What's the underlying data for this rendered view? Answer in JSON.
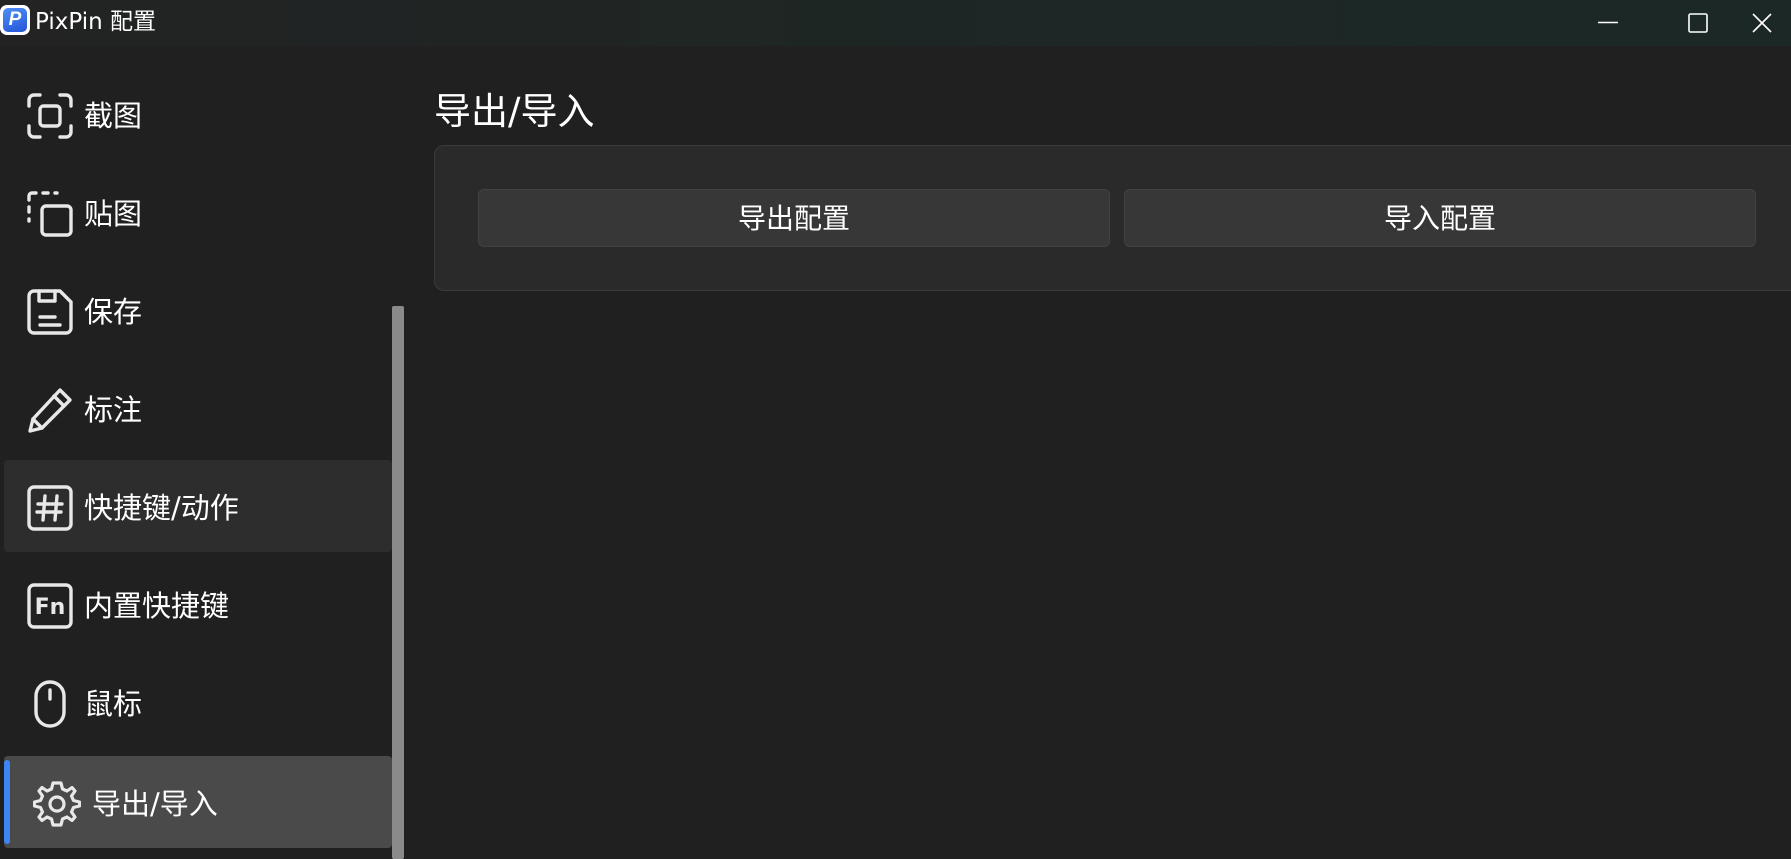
{
  "window": {
    "title": "PixPin 配置",
    "logo_letter": "P",
    "controls": {
      "minimize_icon": "minimize-icon",
      "maximize_icon": "maximize-icon",
      "close_icon": "close-icon"
    }
  },
  "sidebar": {
    "items": [
      {
        "label": "截图",
        "icon": "screenshot-icon"
      },
      {
        "label": "贴图",
        "icon": "pin-image-icon"
      },
      {
        "label": "保存",
        "icon": "save-icon"
      },
      {
        "label": "标注",
        "icon": "pencil-icon"
      },
      {
        "label": "快捷键/动作",
        "icon": "hash-icon",
        "state": "hover"
      },
      {
        "label": "内置快捷键",
        "icon": "fn-key-icon"
      },
      {
        "label": "鼠标",
        "icon": "mouse-icon"
      },
      {
        "label": "导出/导入",
        "icon": "gear-icon",
        "state": "selected"
      }
    ],
    "fn_icon_text": "Fn",
    "hash_icon_text": "#"
  },
  "main": {
    "title": "导出/导入",
    "buttons": {
      "export_label": "导出配置",
      "import_label": "导入配置"
    }
  },
  "colors": {
    "background": "#202020",
    "card": "#2a2a2a",
    "button": "#373737",
    "selected_item": "#4a4a4a",
    "hover_item": "#2d2d2d",
    "accent": "#3c86f4"
  }
}
